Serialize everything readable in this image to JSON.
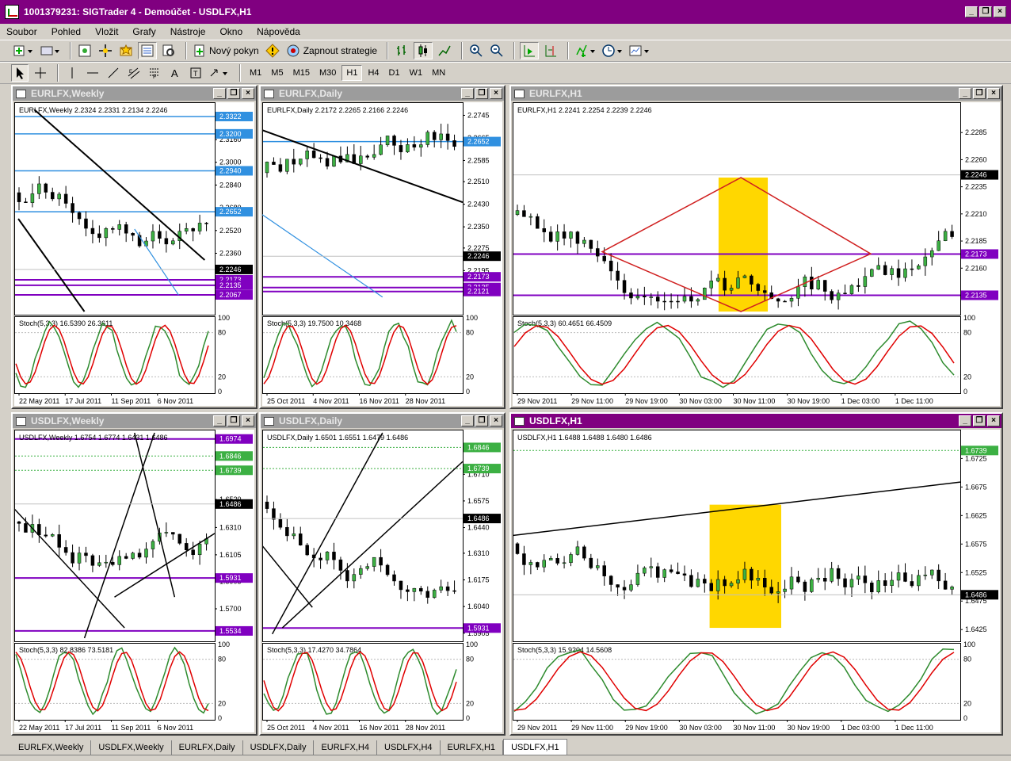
{
  "app": {
    "title": "1001379231: SIGTrader 4 - Demoúčet - USDLFX,H1"
  },
  "menu": [
    "Soubor",
    "Pohled",
    "Vložit",
    "Grafy",
    "Nástroje",
    "Okno",
    "Nápověda"
  ],
  "toolbar1": {
    "new_order": "Nový pokyn",
    "strategy": "Zapnout strategie"
  },
  "timeframes": [
    "M1",
    "M5",
    "M15",
    "M30",
    "H1",
    "H4",
    "D1",
    "W1",
    "MN"
  ],
  "tabs": [
    "EURLFX,Weekly",
    "USDLFX,Weekly",
    "EURLFX,Daily",
    "USDLFX,Daily",
    "EURLFX,H4",
    "USDLFX,H4",
    "EURLFX,H1",
    "USDLFX,H1"
  ],
  "selected_tab": "USDLFX,H1",
  "colors": {
    "bull": "#3cb043",
    "bear": "#000000",
    "purple": "#8000c0",
    "blue": "#3090e0",
    "yellow": "#ffd700",
    "stoch_main": "#2e8b2e",
    "stoch_signal": "#e00000"
  },
  "charts": [
    {
      "id": "c1",
      "title": "EURLFX,Weekly",
      "state": "inactive",
      "header": "EURLFX,Weekly  2.2324 2.2331 2.2134 2.2246",
      "yticks": [
        "2.3160",
        "2.3000",
        "2.2840",
        "2.2680",
        "2.2520",
        "2.2360"
      ],
      "ymin": 2.195,
      "ymax": 2.34,
      "levels": [
        {
          "v": 2.3322,
          "t": "2.3322",
          "c": "blue"
        },
        {
          "v": 2.32,
          "t": "2.3200",
          "c": "blue"
        },
        {
          "v": 2.294,
          "t": "2.2940",
          "c": "blue"
        },
        {
          "v": 2.2652,
          "t": "2.2652",
          "c": "blue"
        },
        {
          "v": 2.2173,
          "t": "2.2173",
          "c": "purple"
        },
        {
          "v": 2.2135,
          "t": "2.2135",
          "c": "purple"
        },
        {
          "v": 2.2067,
          "t": "2.2067",
          "c": "purple"
        }
      ],
      "current": {
        "v": 2.2246,
        "t": "2.2246"
      },
      "stoch": "Stoch(5,3,3) 16.5390 26.3611",
      "xticks": [
        "22 May 2011",
        "17 Jul 2011",
        "11 Sep 2011",
        "6 Nov 2011"
      ]
    },
    {
      "id": "c2",
      "title": "EURLFX,Daily",
      "state": "inactive",
      "header": "EURLFX,Daily  2.2172 2.2265 2.2166 2.2246",
      "yticks": [
        "2.2745",
        "2.2665",
        "2.2585",
        "2.2510",
        "2.2430",
        "2.2350",
        "2.2275",
        "2.2195"
      ],
      "ymin": 2.205,
      "ymax": 2.278,
      "levels": [
        {
          "v": 2.2652,
          "t": "2.2652",
          "c": "blue"
        },
        {
          "v": 2.2173,
          "t": "2.2173",
          "c": "purple"
        },
        {
          "v": 2.2135,
          "t": "2.2135",
          "c": "purple"
        },
        {
          "v": 2.2121,
          "t": "2.2121",
          "c": "purple"
        }
      ],
      "current": {
        "v": 2.2246,
        "t": "2.2246"
      },
      "stoch": "Stoch(5,3,3) 19.7500 10.3468",
      "xticks": [
        "25 Oct 2011",
        "4 Nov 2011",
        "16 Nov 2011",
        "28 Nov 2011"
      ]
    },
    {
      "id": "c3",
      "title": "EURLFX,H1",
      "state": "inactive",
      "header": "EURLFX,H1  2.2241 2.2254 2.2239 2.2246",
      "yticks": [
        "2.2285",
        "2.2260",
        "2.2235",
        "2.2210",
        "2.2185",
        "2.2160"
      ],
      "ymin": 2.212,
      "ymax": 2.231,
      "levels": [
        {
          "v": 2.2173,
          "t": "2.2173",
          "c": "purple"
        },
        {
          "v": 2.2135,
          "t": "2.2135",
          "c": "purple"
        }
      ],
      "current": {
        "v": 2.2246,
        "t": "2.2246"
      },
      "stoch": "Stoch(5,3,3) 60.4651 66.4509",
      "xticks": [
        "29 Nov 2011",
        "29 Nov 11:00",
        "29 Nov 19:00",
        "30 Nov 03:00",
        "30 Nov 11:00",
        "30 Nov 19:00",
        "1 Dec 03:00",
        "1 Dec 11:00"
      ]
    },
    {
      "id": "c4",
      "title": "USDLFX,Weekly",
      "state": "inactive",
      "header": "USDLFX,Weekly  1.6754 1.6774 1.6431 1.6486",
      "yticks": [
        "1.6735",
        "1.6520",
        "1.6310",
        "1.6105",
        "1.5905",
        "1.5700"
      ],
      "ymin": 1.548,
      "ymax": 1.702,
      "levels": [
        {
          "v": 1.6974,
          "t": "1.6974",
          "c": "purple"
        },
        {
          "v": 1.6846,
          "t": "1.6846",
          "c": "green"
        },
        {
          "v": 1.6739,
          "t": "1.6739",
          "c": "green"
        },
        {
          "v": 1.5931,
          "t": "1.5931",
          "c": "purple"
        },
        {
          "v": 1.5534,
          "t": "1.5534",
          "c": "purple"
        }
      ],
      "current": {
        "v": 1.6486,
        "t": "1.6486"
      },
      "stoch": "Stoch(5,3,3) 82.8386 73.5181",
      "xticks": [
        "22 May 2011",
        "17 Jul 2011",
        "11 Sep 2011",
        "6 Nov 2011"
      ]
    },
    {
      "id": "c5",
      "title": "USDLFX,Daily",
      "state": "inactive",
      "header": "USDLFX,Daily  1.6501 1.6551 1.6479 1.6486",
      "yticks": [
        "1.6710",
        "1.6575",
        "1.6440",
        "1.6310",
        "1.6175",
        "1.6040",
        "1.5905"
      ],
      "ymin": 1.588,
      "ymax": 1.692,
      "levels": [
        {
          "v": 1.6846,
          "t": "1.6846",
          "c": "green"
        },
        {
          "v": 1.6739,
          "t": "1.6739",
          "c": "green"
        },
        {
          "v": 1.5931,
          "t": "1.5931",
          "c": "purple"
        }
      ],
      "current": {
        "v": 1.6486,
        "t": "1.6486"
      },
      "stoch": "Stoch(5,3,3) 17.4270 34.7864",
      "xticks": [
        "25 Oct 2011",
        "4 Nov 2011",
        "16 Nov 2011",
        "28 Nov 2011"
      ]
    },
    {
      "id": "c6",
      "title": "USDLFX,H1",
      "state": "active",
      "header": "USDLFX,H1  1.6488 1.6488 1.6480 1.6486",
      "yticks": [
        "1.6725",
        "1.6675",
        "1.6625",
        "1.6575",
        "1.6525",
        "1.6475",
        "1.6425"
      ],
      "ymin": 1.641,
      "ymax": 1.677,
      "levels": [
        {
          "v": 1.6739,
          "t": "1.6739",
          "c": "green"
        }
      ],
      "current": {
        "v": 1.6486,
        "t": "1.6486"
      },
      "stoch": "Stoch(5,3,3) 15.9204 14.5608",
      "xticks": [
        "29 Nov 2011",
        "29 Nov 11:00",
        "29 Nov 19:00",
        "30 Nov 03:00",
        "30 Nov 11:00",
        "30 Nov 19:00",
        "1 Dec 03:00",
        "1 Dec 11:00"
      ]
    }
  ],
  "stoch_levels": [
    "100",
    "80",
    "20",
    "0"
  ]
}
